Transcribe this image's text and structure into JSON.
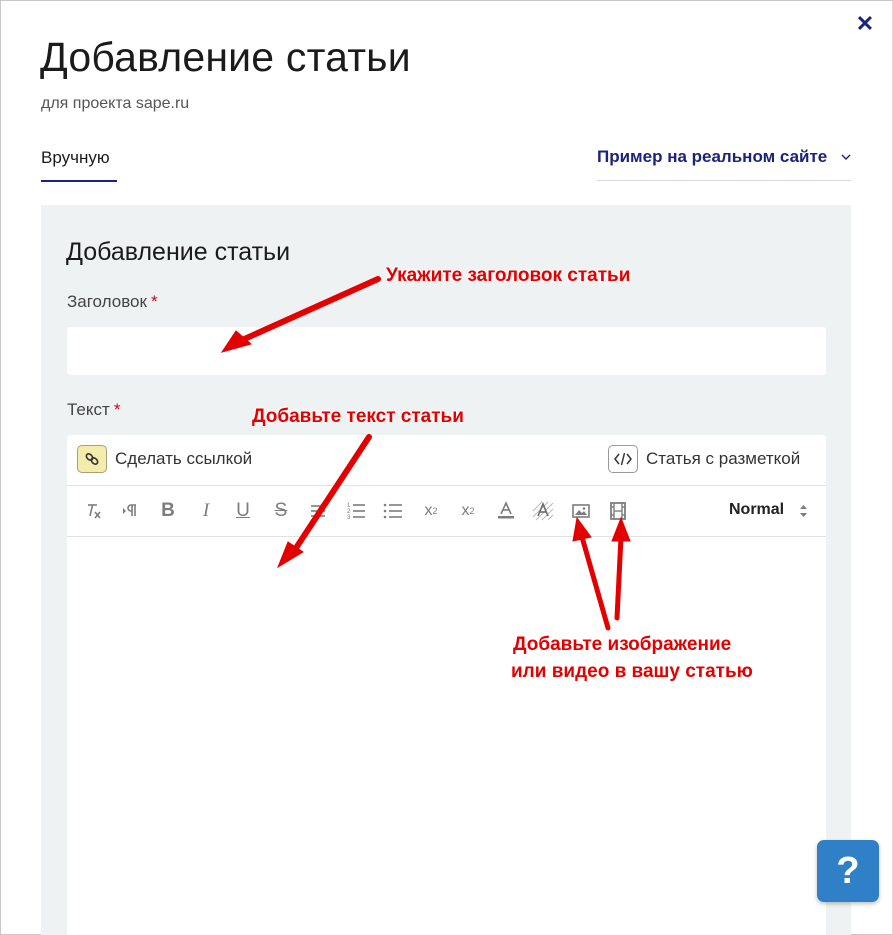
{
  "dialog": {
    "title": "Добавление статьи",
    "subtitle": "для проекта sape.ru",
    "close_icon": "close-icon"
  },
  "tabs": {
    "manual": "Вручную",
    "example": "Пример на реальном сайте"
  },
  "form": {
    "heading": "Добавление статьи",
    "title_label": "Заголовок",
    "text_label": "Текст",
    "required_mark": "*",
    "title_value": "",
    "make_link_label": "Сделать ссылкой",
    "markup_label": "Статья с разметкой",
    "format_select_value": "Normal",
    "toolbar_icons": [
      "clear-format-icon",
      "text-direction-icon",
      "bold-icon",
      "italic-icon",
      "underline-icon",
      "strikethrough-icon",
      "align-icon",
      "ordered-list-icon",
      "bullet-list-icon",
      "subscript-icon",
      "superscript-icon",
      "text-color-icon",
      "background-color-icon",
      "image-icon",
      "video-icon"
    ]
  },
  "annotations": {
    "title_hint": "Укажите заголовок статьи",
    "text_hint": "Добавьте текст статьи",
    "media_hint_line1": "Добавьте изображение",
    "media_hint_line2": "или видео в вашу статью",
    "color": "#e30000"
  },
  "help_button": "?",
  "colors": {
    "accent": "#1a237e",
    "panel": "#eff2f3",
    "help": "#2f80c6",
    "required": "#d0021b"
  }
}
